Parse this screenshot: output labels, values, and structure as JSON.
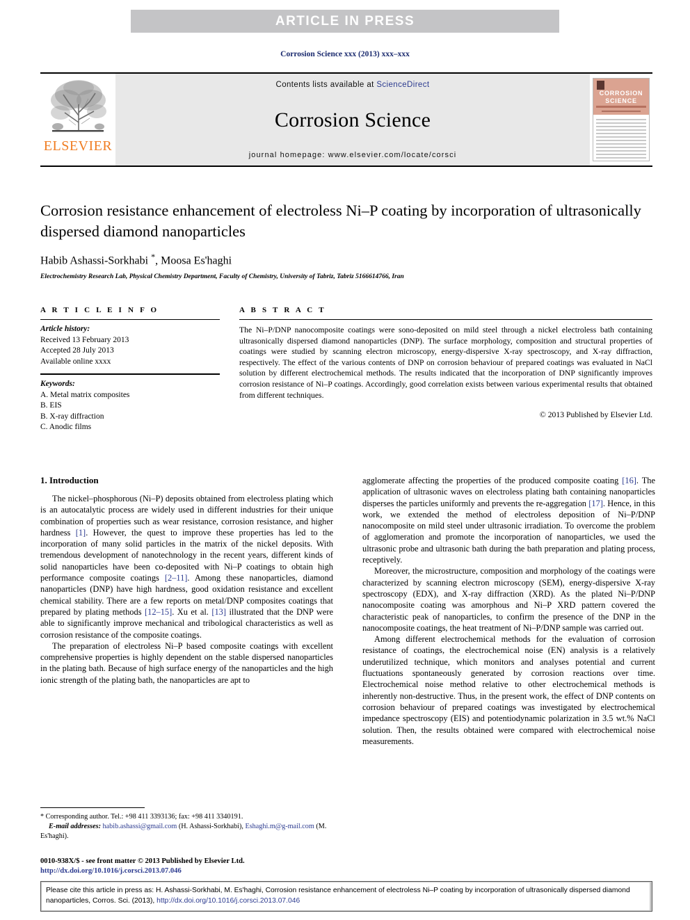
{
  "banner": {
    "text": "ARTICLE  IN  PRESS",
    "bg_color": "#c4c4c6",
    "text_color": "#ffffff"
  },
  "running_head": "Corrosion Science xxx (2013) xxx–xxx",
  "masthead": {
    "publisher_logo_text": "ELSEVIER",
    "publisher_logo_color": "#f07d22",
    "contents_prefix": "Contents lists available at ",
    "contents_link": "ScienceDirect",
    "journal_title": "Corrosion Science",
    "homepage": "journal homepage: www.elsevier.com/locate/corsci",
    "cover": {
      "line1": "CORROSION",
      "line2": "SCIENCE",
      "bg_color": "#dba391"
    }
  },
  "article": {
    "title": "Corrosion resistance enhancement of electroless Ni–P coating by incorporation of ultrasonically dispersed diamond nanoparticles",
    "authors": "Habib Ashassi-Sorkhabi ",
    "corresponding_marker": "*",
    "authors_rest": ", Moosa Es'haghi",
    "affiliation": "Electrochemistry Research Lab, Physical Chemistry Department, Faculty of Chemistry, University of Tabriz, Tabriz 5166614766, Iran"
  },
  "article_info": {
    "heading": "A R T I C L E   I N F O",
    "history_label": "Article history:",
    "history": [
      "Received 13 February 2013",
      "Accepted 28 July 2013",
      "Available online xxxx"
    ],
    "keywords_label": "Keywords:",
    "keywords": [
      "A. Metal matrix composites",
      "B. EIS",
      "B. X-ray diffraction",
      "C. Anodic films"
    ]
  },
  "abstract": {
    "heading": "A B S T R A C T",
    "text": "The Ni–P/DNP nanocomposite coatings were sono-deposited on mild steel through a nickel electroless bath containing ultrasonically dispersed diamond nanoparticles (DNP). The surface morphology, composition and structural properties of coatings were studied by scanning electron microscopy, energy-dispersive X-ray spectroscopy, and X-ray diffraction, respectively. The effect of the various contents of DNP on corrosion behaviour of prepared coatings was evaluated in NaCl solution by different electrochemical methods. The results indicated that the incorporation of DNP significantly improves corrosion resistance of Ni–P coatings. Accordingly, good correlation exists between various experimental results that obtained from different techniques.",
    "copyright": "© 2013 Published by Elsevier Ltd."
  },
  "introduction": {
    "section_title": "1. Introduction",
    "left_paragraphs": [
      "The nickel–phosphorous (Ni–P) deposits obtained from electroless plating which is an autocatalytic process are widely used in different industries for their unique combination of properties such as wear resistance, corrosion resistance, and higher hardness [1]. However, the quest to improve these properties has led to the incorporation of many solid particles in the matrix of the nickel deposits. With tremendous development of nanotechnology in the recent years, different kinds of solid nanoparticles have been co-deposited with Ni–P coatings to obtain high performance composite coatings [2–11]. Among these nanoparticles, diamond nanoparticles (DNP) have high hardness, good oxidation resistance and excellent chemical stability. There are a few reports on metal/DNP composites coatings that prepared by plating methods [12–15]. Xu et al. [13] illustrated that the DNP were able to significantly improve mechanical and tribological characteristics as well as corrosion resistance of the composite coatings.",
      "The preparation of electroless Ni–P based composite coatings with excellent comprehensive properties is highly dependent on the stable dispersed nanoparticles in the plating bath. Because of high surface energy of the nanoparticles and the high ionic strength of the plating bath, the nanoparticles are apt to"
    ],
    "right_paragraphs": [
      "agglomerate affecting the properties of the produced composite coating [16]. The application of ultrasonic waves on electroless plating bath containing nanoparticles disperses the particles uniformly and prevents the re-aggregation [17]. Hence, in this work, we extended the method of electroless deposition of Ni–P/DNP nanocomposite on mild steel under ultrasonic irradiation. To overcome the problem of agglomeration and promote the incorporation of nanoparticles, we used the ultrasonic probe and ultrasonic bath during the bath preparation and plating process, receptively.",
      "Moreover, the microstructure, composition and morphology of the coatings were characterized by scanning electron microscopy (SEM), energy-dispersive X-ray spectroscopy (EDX), and X-ray diffraction (XRD). As the plated Ni–P/DNP nanocomposite coating was amorphous and Ni–P XRD pattern covered the characteristic peak of nanoparticles, to confirm the presence of the DNP in the nanocomposite coatings, the heat treatment of Ni–P/DNP sample was carried out.",
      "Among different electrochemical methods for the evaluation of corrosion resistance of coatings, the electrochemical noise (EN) analysis is a relatively underutilized technique, which monitors and analyses potential and current fluctuations spontaneously generated by corrosion reactions over time. Electrochemical noise method relative to other electrochemical methods is inherently non-destructive. Thus, in the present work, the effect of DNP contents on corrosion behaviour of prepared coatings was investigated by electrochemical impedance spectroscopy (EIS) and potentiodynamic polarization in 3.5 wt.% NaCl solution. Then, the results obtained were compared with electrochemical noise measurements."
    ]
  },
  "footnote": {
    "marker": "*",
    "corresponding": "Corresponding author. Tel.: +98 411 3393136; fax: +98 411 3340191.",
    "email_label": "E-mail addresses:",
    "email1": "habib.ashassi@gmail.com",
    "email1_owner": "(H. Ashassi-Sorkhabi),",
    "email2": "Eshaghi.m@g-mail.com",
    "email2_owner": "(M. Es'haghi)."
  },
  "issn_line": "0010-938X/$ - see front matter © 2013 Published by Elsevier Ltd.",
  "issn_doi": "http://dx.doi.org/10.1016/j.corsci.2013.07.046",
  "cite_box": {
    "text_before_doi": "Please cite this article in press as: H. Ashassi-Sorkhabi, M. Es'haghi, Corrosion resistance enhancement of electroless Ni–P coating by incorporation of ultrasonically dispersed diamond nanoparticles, Corros. Sci. (2013), ",
    "doi": "http://dx.doi.org/10.1016/j.corsci.2013.07.046"
  }
}
